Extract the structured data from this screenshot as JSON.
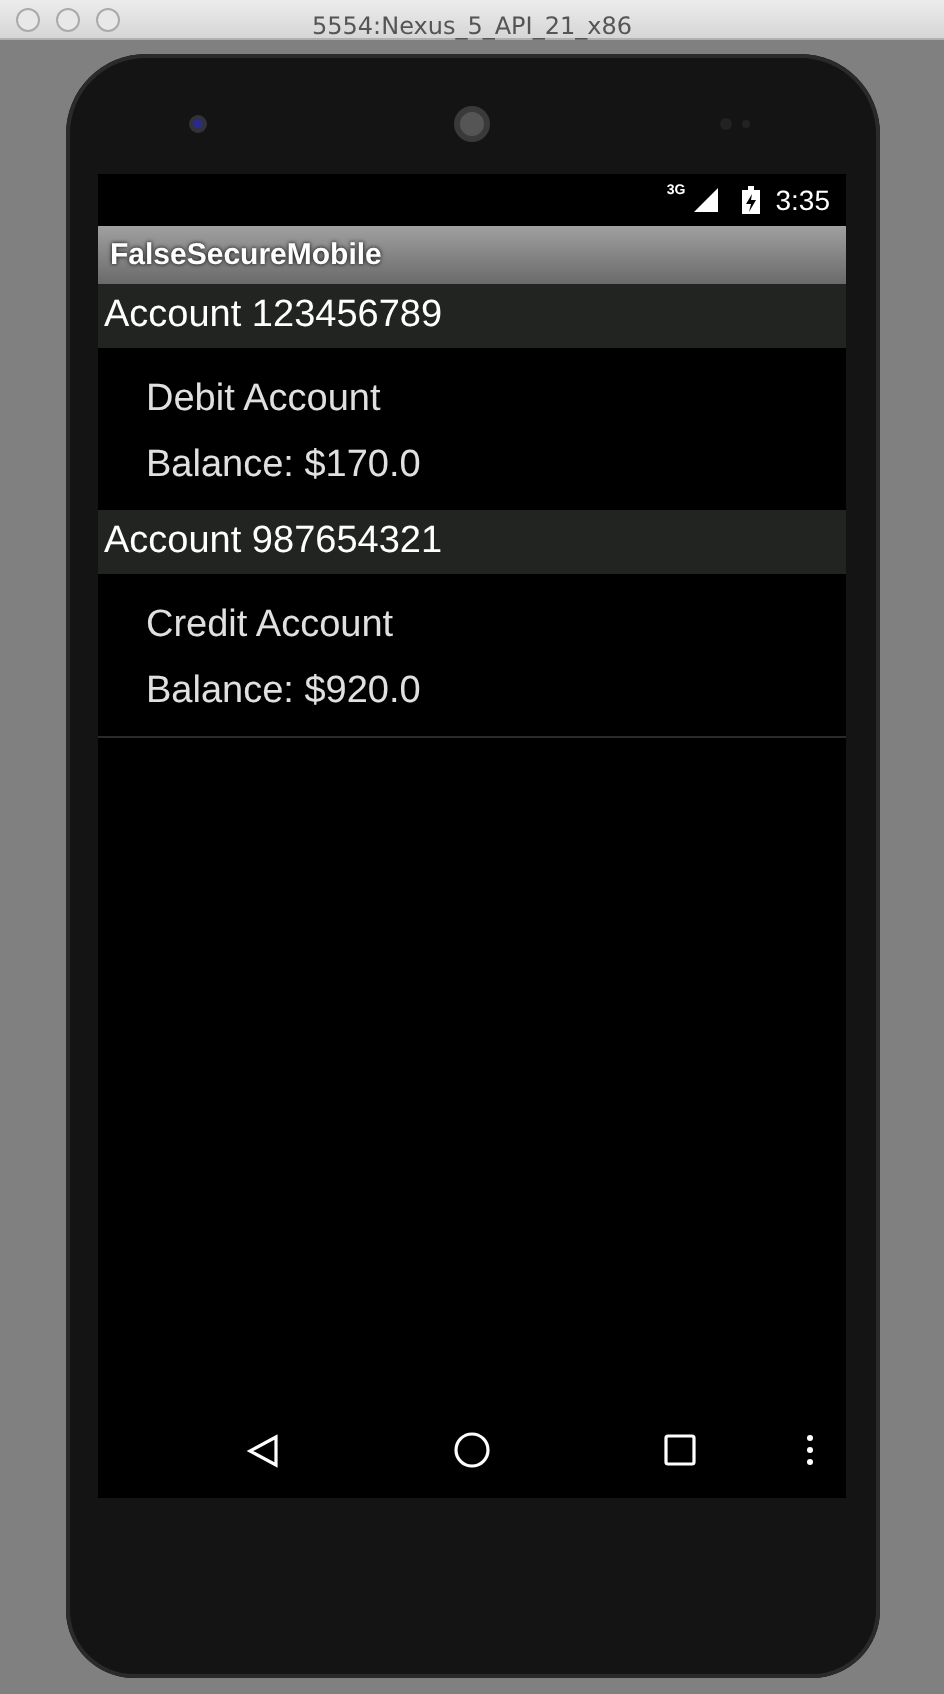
{
  "window": {
    "title": "5554:Nexus_5_API_21_x86"
  },
  "status_bar": {
    "network": "3G",
    "time": "3:35"
  },
  "app_bar": {
    "title": "FalseSecureMobile"
  },
  "accounts": [
    {
      "header": "Account 123456789",
      "type": "Debit Account",
      "balance": "Balance: $170.0"
    },
    {
      "header": "Account 987654321",
      "type": "Credit Account",
      "balance": "Balance: $920.0"
    }
  ]
}
